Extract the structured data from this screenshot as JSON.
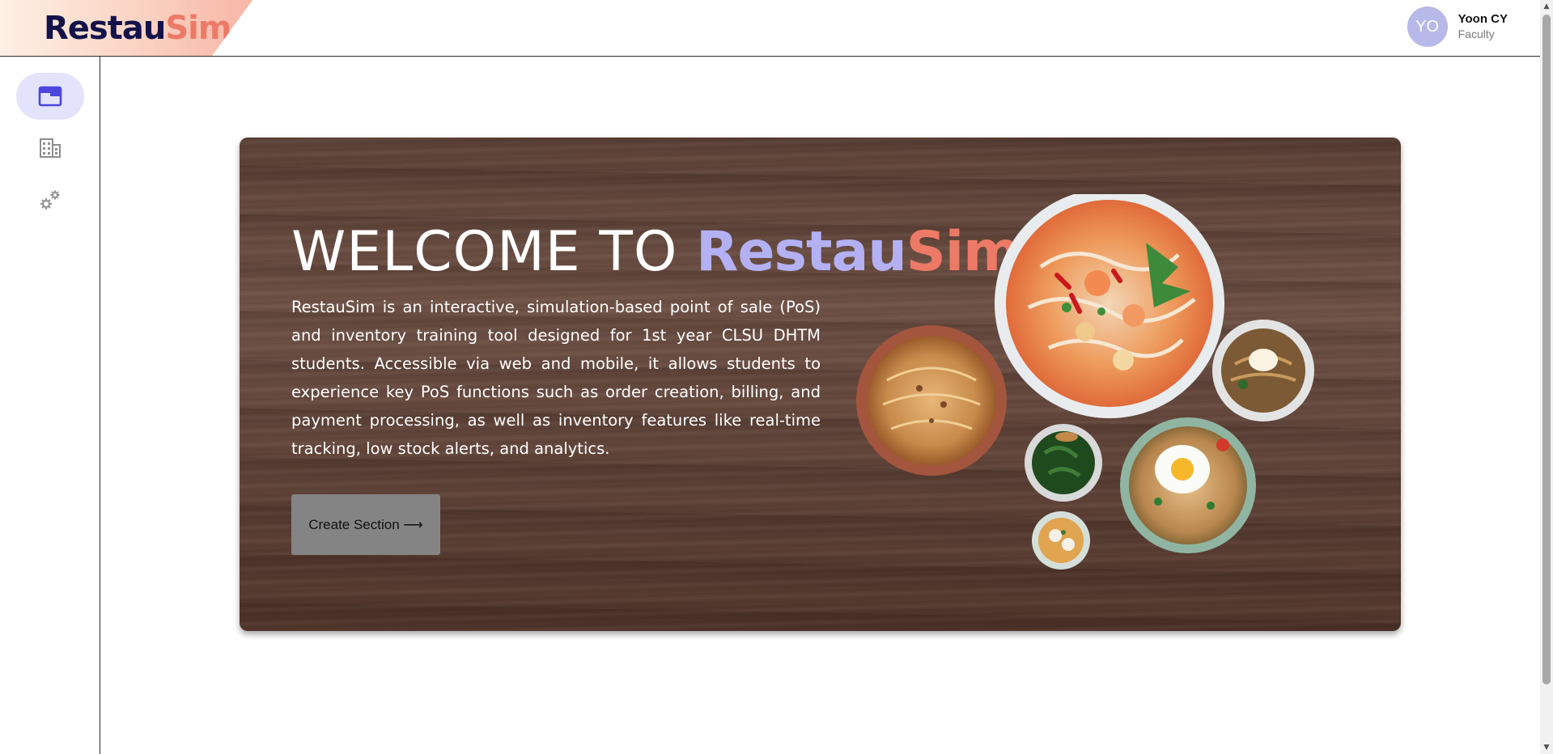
{
  "header": {
    "logo_part1": "Restau",
    "logo_part2": "Sim.",
    "user": {
      "initials": "YO",
      "name": "Yoon CY",
      "role": "Faculty"
    }
  },
  "sidebar": {
    "items": [
      {
        "icon": "dashboard-window-icon",
        "active": true
      },
      {
        "icon": "building-icon",
        "active": false
      },
      {
        "icon": "settings-gears-icon",
        "active": false
      }
    ]
  },
  "hero": {
    "title_prefix": "WELCOME TO ",
    "title_brand1": "Restau",
    "title_brand2": "Sim.",
    "description": "RestauSim is an interactive, simulation-based point of sale (PoS) and inventory training tool designed for 1st year CLSU DHTM students. Accessible via web and mobile, it allows students to experience key PoS functions such as order creation, billing, and payment processing, as well as inventory features like real-time tracking, low stock alerts, and analytics.",
    "button_label": "Create Section ⟶"
  },
  "colors": {
    "brand_dark": "#14124a",
    "brand_coral": "#ec7a66",
    "brand_lavender": "#b3b1f4",
    "active_nav_bg": "#e3e3fb",
    "avatar_bg": "#b7b9e8"
  }
}
